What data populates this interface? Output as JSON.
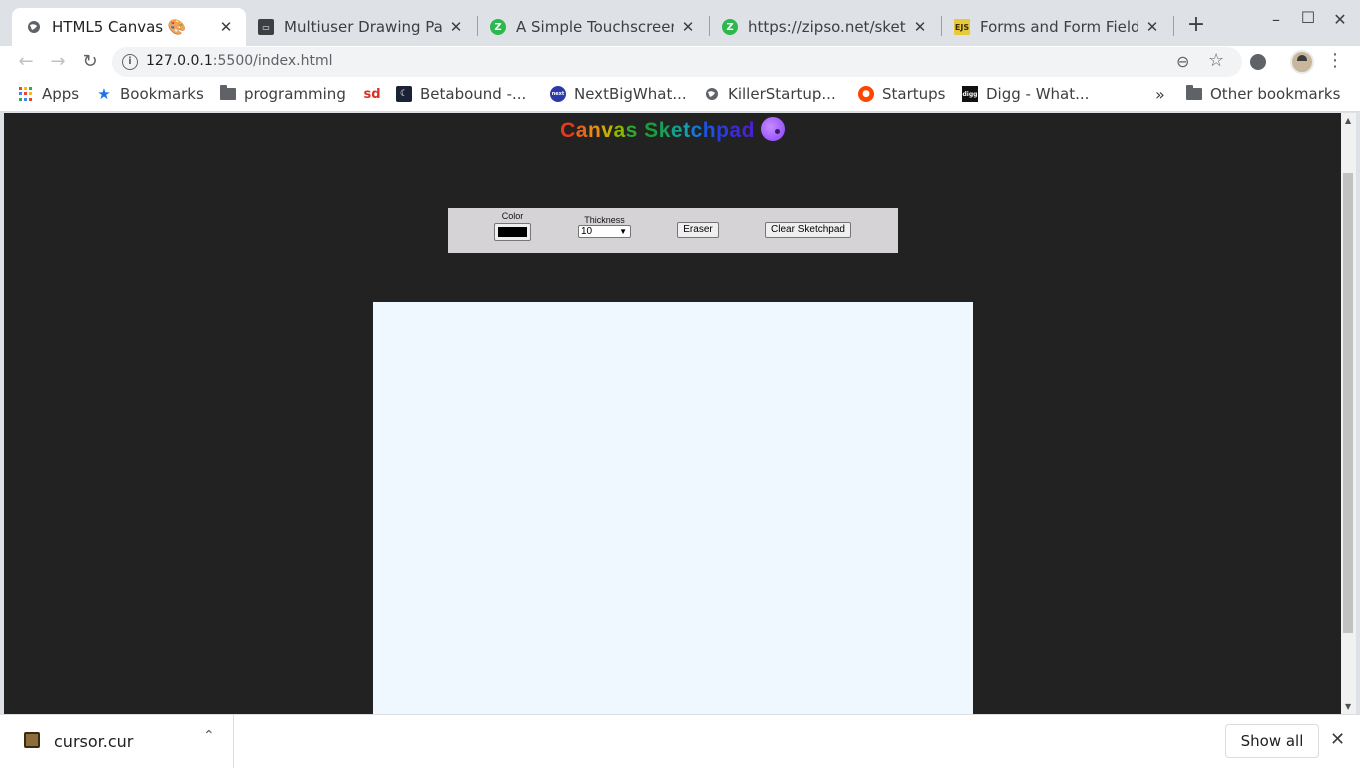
{
  "tabs": [
    {
      "title": "HTML5 Canvas 🎨",
      "favicon": "globe-icon",
      "active": true
    },
    {
      "title": "Multiuser Drawing Pad",
      "favicon": "site-icon",
      "active": false
    },
    {
      "title": "A Simple Touchscreen",
      "favicon": "zipso-icon",
      "active": false
    },
    {
      "title": "https://zipso.net/sketch",
      "favicon": "zipso-icon",
      "active": false
    },
    {
      "title": "Forms and Form Fields",
      "favicon": "ejs-icon",
      "active": false
    }
  ],
  "tab_close": "✕",
  "new_tab": "+",
  "window_controls": {
    "minimize": "–",
    "maximize": "☐",
    "close": "✕"
  },
  "toolbar": {
    "back": "←",
    "forward": "→",
    "reload": "↻",
    "url_host": "127.0.0.1",
    "url_path": ":5500/index.html",
    "info": "i",
    "zoom": "⊖",
    "star": "☆",
    "menu": "⋮"
  },
  "bookmarks": [
    {
      "label": "Apps",
      "icon": "apps-grid-icon"
    },
    {
      "label": "Bookmarks",
      "icon": "star-icon"
    },
    {
      "label": "programming",
      "icon": "folder-icon"
    },
    {
      "label": "",
      "icon": "sd-icon",
      "icon_text": "sd"
    },
    {
      "label": "Betabound -...",
      "icon": "betabound-icon"
    },
    {
      "label": "NextBigWhat...",
      "icon": "nextbigwhat-icon",
      "icon_text": "next"
    },
    {
      "label": "KillerStartup...",
      "icon": "globe-icon"
    },
    {
      "label": "Startups",
      "icon": "reddit-icon"
    },
    {
      "label": "Digg - What...",
      "icon": "digg-icon",
      "icon_text": "digg"
    }
  ],
  "bookmarks_overflow": "»",
  "other_bookmarks": "Other bookmarks",
  "page": {
    "title_letters": [
      "C",
      "a",
      "n",
      "v",
      "a",
      "s",
      " ",
      "S",
      "k",
      "e",
      "t",
      "c",
      "h",
      "p",
      "a",
      "d"
    ],
    "title_colors": [
      "#e63a1e",
      "#e8641a",
      "#e88a14",
      "#c8b000",
      "#8ab800",
      "#2fa82f",
      "#222222",
      "#1a9e3a",
      "#16a05a",
      "#14a08a",
      "#129fb4",
      "#1478d8",
      "#1a54e0",
      "#2a3ce0",
      "#3a2ad8",
      "#4a22d0"
    ],
    "color_label": "Color",
    "color_value": "#000000",
    "thickness_label": "Thickness",
    "thickness_value": "10",
    "thickness_arrow": "▼",
    "eraser_label": "Eraser",
    "clear_label": "Clear Sketchpad",
    "canvas_color": "#f0f8ff",
    "background": "#222222"
  },
  "scrollbar": {
    "up": "▲",
    "down": "▼"
  },
  "downloads": {
    "file_name": "cursor.cur",
    "chevron": "⌃",
    "show_all": "Show all",
    "close": "✕"
  }
}
